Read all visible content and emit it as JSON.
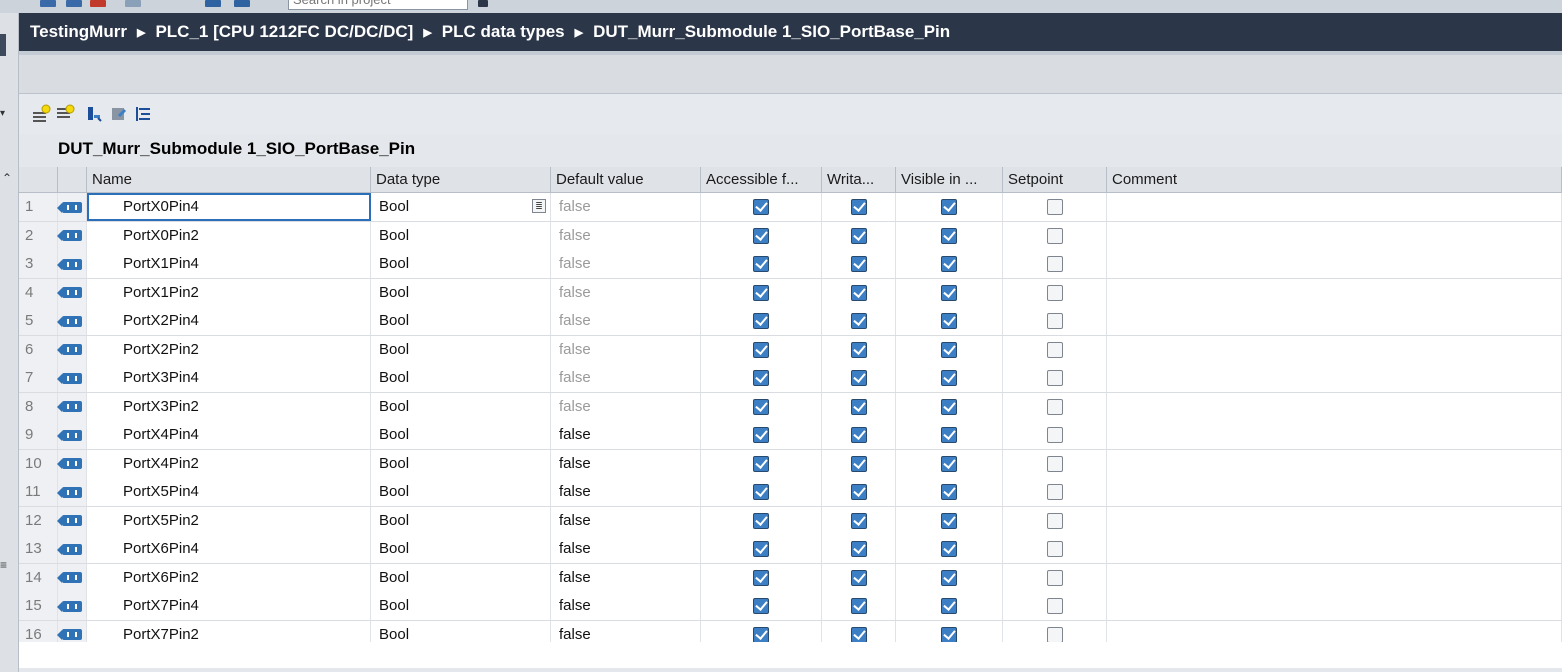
{
  "search": {
    "placeholder": "Search in project"
  },
  "breadcrumb": {
    "items": [
      "TestingMurr",
      "PLC_1 [CPU 1212FC DC/DC/DC]",
      "PLC data types",
      "DUT_Murr_Submodule 1_SIO_PortBase_Pin"
    ]
  },
  "editor": {
    "title": "DUT_Murr_Submodule 1_SIO_PortBase_Pin"
  },
  "columns": {
    "name": "Name",
    "data_type": "Data type",
    "default_value": "Default value",
    "accessible": "Accessible f...",
    "writable": "Writa...",
    "visible": "Visible in ...",
    "setpoint": "Setpoint",
    "comment": "Comment"
  },
  "rows": [
    {
      "num": "1",
      "name": "PortX0Pin4",
      "type": "Bool",
      "default": "false",
      "default_grey": true,
      "accessible": true,
      "writable": true,
      "visible": true,
      "setpoint": false,
      "comment": ""
    },
    {
      "num": "2",
      "name": "PortX0Pin2",
      "type": "Bool",
      "default": "false",
      "default_grey": true,
      "accessible": true,
      "writable": true,
      "visible": true,
      "setpoint": false,
      "comment": ""
    },
    {
      "num": "3",
      "name": "PortX1Pin4",
      "type": "Bool",
      "default": "false",
      "default_grey": true,
      "accessible": true,
      "writable": true,
      "visible": true,
      "setpoint": false,
      "comment": ""
    },
    {
      "num": "4",
      "name": "PortX1Pin2",
      "type": "Bool",
      "default": "false",
      "default_grey": true,
      "accessible": true,
      "writable": true,
      "visible": true,
      "setpoint": false,
      "comment": ""
    },
    {
      "num": "5",
      "name": "PortX2Pin4",
      "type": "Bool",
      "default": "false",
      "default_grey": true,
      "accessible": true,
      "writable": true,
      "visible": true,
      "setpoint": false,
      "comment": ""
    },
    {
      "num": "6",
      "name": "PortX2Pin2",
      "type": "Bool",
      "default": "false",
      "default_grey": true,
      "accessible": true,
      "writable": true,
      "visible": true,
      "setpoint": false,
      "comment": ""
    },
    {
      "num": "7",
      "name": "PortX3Pin4",
      "type": "Bool",
      "default": "false",
      "default_grey": true,
      "accessible": true,
      "writable": true,
      "visible": true,
      "setpoint": false,
      "comment": ""
    },
    {
      "num": "8",
      "name": "PortX3Pin2",
      "type": "Bool",
      "default": "false",
      "default_grey": true,
      "accessible": true,
      "writable": true,
      "visible": true,
      "setpoint": false,
      "comment": ""
    },
    {
      "num": "9",
      "name": "PortX4Pin4",
      "type": "Bool",
      "default": "false",
      "default_grey": false,
      "accessible": true,
      "writable": true,
      "visible": true,
      "setpoint": false,
      "comment": ""
    },
    {
      "num": "10",
      "name": "PortX4Pin2",
      "type": "Bool",
      "default": "false",
      "default_grey": false,
      "accessible": true,
      "writable": true,
      "visible": true,
      "setpoint": false,
      "comment": ""
    },
    {
      "num": "11",
      "name": "PortX5Pin4",
      "type": "Bool",
      "default": "false",
      "default_grey": false,
      "accessible": true,
      "writable": true,
      "visible": true,
      "setpoint": false,
      "comment": ""
    },
    {
      "num": "12",
      "name": "PortX5Pin2",
      "type": "Bool",
      "default": "false",
      "default_grey": false,
      "accessible": true,
      "writable": true,
      "visible": true,
      "setpoint": false,
      "comment": ""
    },
    {
      "num": "13",
      "name": "PortX6Pin4",
      "type": "Bool",
      "default": "false",
      "default_grey": false,
      "accessible": true,
      "writable": true,
      "visible": true,
      "setpoint": false,
      "comment": ""
    },
    {
      "num": "14",
      "name": "PortX6Pin2",
      "type": "Bool",
      "default": "false",
      "default_grey": false,
      "accessible": true,
      "writable": true,
      "visible": true,
      "setpoint": false,
      "comment": ""
    },
    {
      "num": "15",
      "name": "PortX7Pin4",
      "type": "Bool",
      "default": "false",
      "default_grey": false,
      "accessible": true,
      "writable": true,
      "visible": true,
      "setpoint": false,
      "comment": ""
    },
    {
      "num": "16",
      "name": "PortX7Pin2",
      "type": "Bool",
      "default": "false",
      "default_grey": false,
      "accessible": true,
      "writable": true,
      "visible": true,
      "setpoint": false,
      "comment": ""
    }
  ],
  "colors": {
    "breadcrumb_bg": "#2b3648",
    "checkbox_on": "#3d7fc4",
    "selection": "#2b6fb8"
  }
}
